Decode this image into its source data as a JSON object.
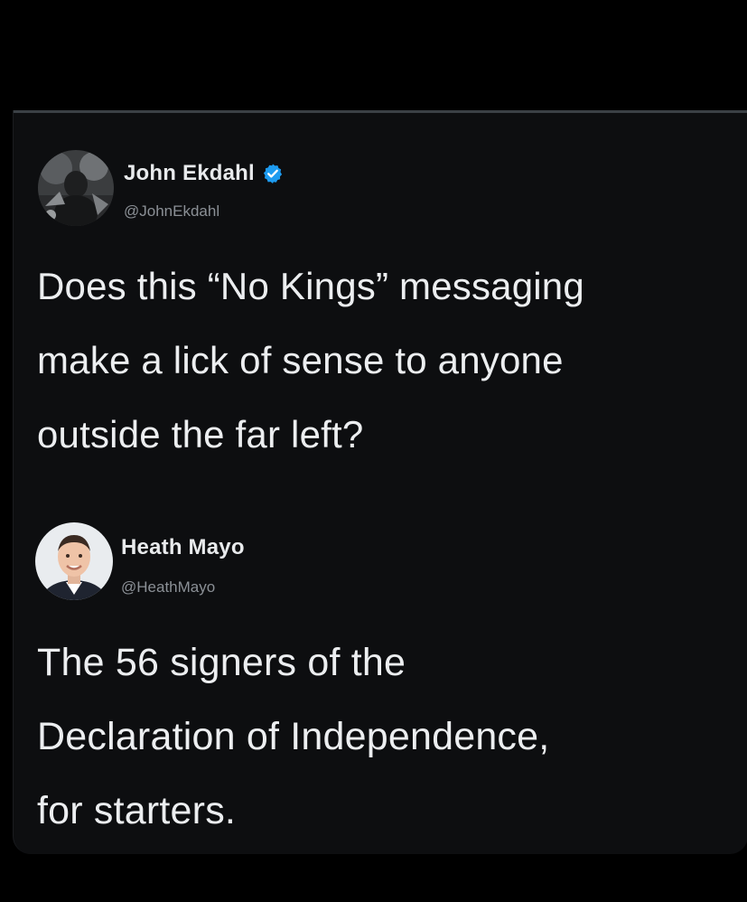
{
  "tweets": [
    {
      "display_name": "John Ekdahl",
      "handle": "@JohnEkdahl",
      "verified": true,
      "avatar_icon": "profile-photo-john",
      "lines": [
        "Does this “No Kings” messaging",
        "make a lick of sense to anyone",
        "outside the far left?"
      ]
    },
    {
      "display_name": "Heath Mayo",
      "handle": "@HeathMayo",
      "verified": false,
      "avatar_icon": "profile-photo-heath",
      "lines": [
        "The 56 signers of the",
        "Declaration of Independence,",
        "for starters."
      ]
    }
  ],
  "colors": {
    "background": "#000000",
    "card": "#0d0e10",
    "text": "#eceef0",
    "handle": "#8b9096",
    "verified": "#1d9bf0"
  }
}
